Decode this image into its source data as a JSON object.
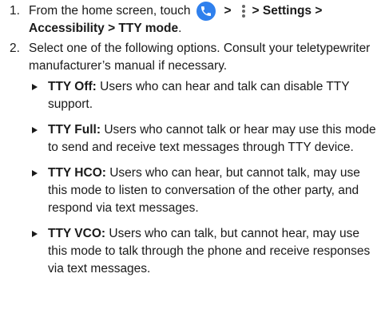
{
  "steps": [
    {
      "number": "1.",
      "text_before": "From the home screen, touch",
      "sep1": ">",
      "sep2": "> Settings >",
      "line2": "Accessibility > TTY mode",
      "line2_end": ".",
      "phone_icon": "phone-icon",
      "menu_icon": "more-vert-icon",
      "phone_icon_color": "#2f80ed"
    },
    {
      "number": "2.",
      "text": "Select one of the following options. Consult your teletypewriter manufacturer’s manual if necessary."
    }
  ],
  "options": [
    {
      "label": "TTY Off:",
      "description": "Users who can hear and talk can disable TTY support."
    },
    {
      "label": "TTY Full:",
      "description": "Users who cannot talk or hear may use this mode to send and receive text messages through TTY device."
    },
    {
      "label": "TTY HCO:",
      "description": "Users who can hear, but cannot talk, may use this mode to listen to conversation of the other party, and respond via text messages."
    },
    {
      "label": "TTY VCO:",
      "description": "Users who can talk, but cannot hear, may use this mode to talk through the phone and receive responses via text messages."
    }
  ]
}
